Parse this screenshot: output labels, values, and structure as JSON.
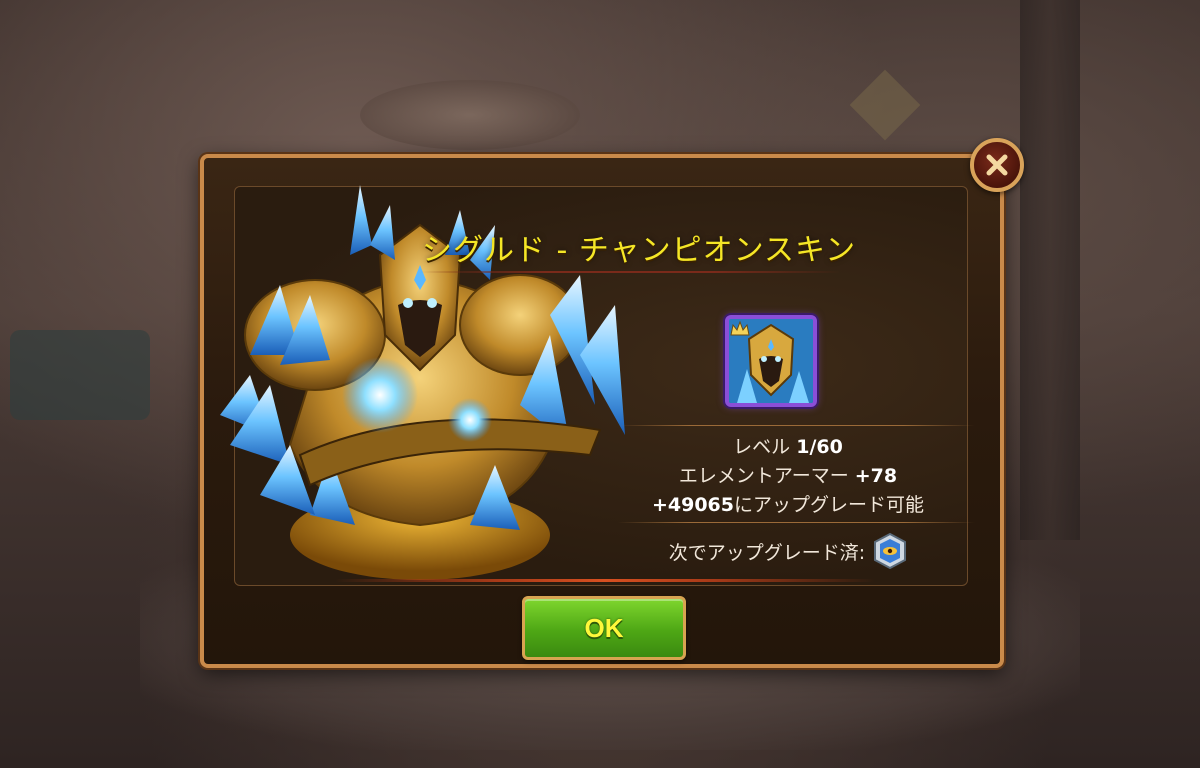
{
  "dialog": {
    "title": "シグルド - チャンピオンスキン",
    "stats": {
      "level_label": "レベル",
      "level_value": "1/60",
      "armor_label": "エレメントアーマー",
      "armor_value": "+78",
      "upgrade_value": "+49065",
      "upgrade_label": "にアップグレード可能"
    },
    "upgrade_with_label": "次でアップグレード済:",
    "ok_label": "OK"
  },
  "icons": {
    "close": "close-icon",
    "element": "element-emblem-icon",
    "portrait": "hero-portrait"
  },
  "colors": {
    "title": "#f5e626",
    "frame": "#c98a4a",
    "ok_button": "#4ea715",
    "portrait_border": "#8a4fd8"
  }
}
